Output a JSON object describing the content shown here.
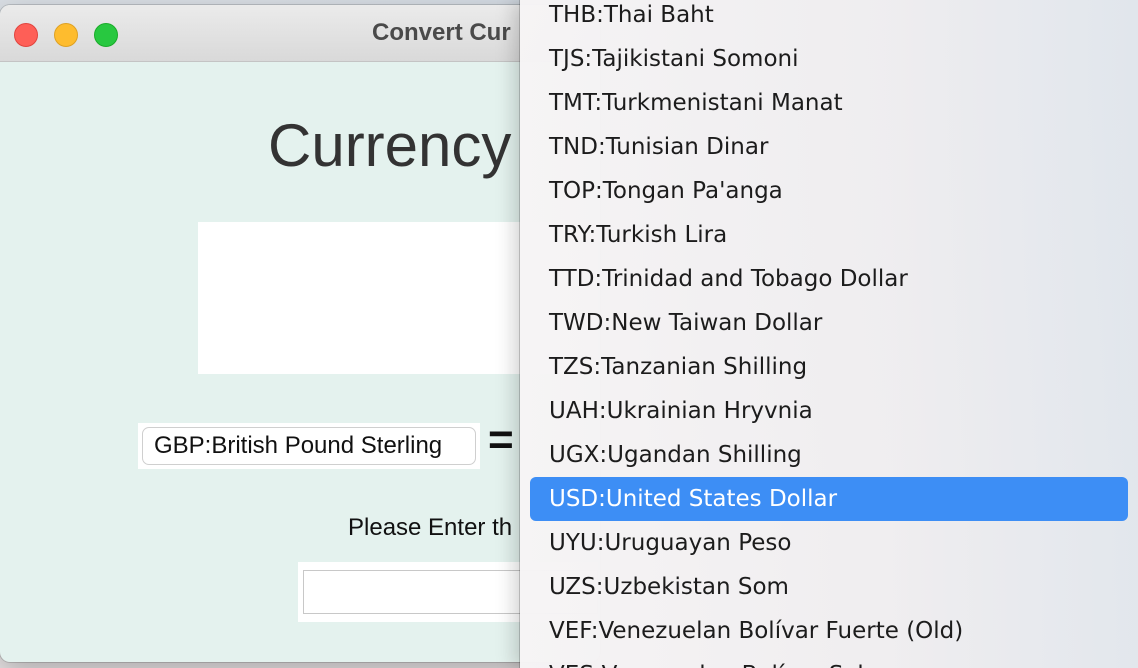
{
  "window": {
    "title": "Convert Cur"
  },
  "app": {
    "heading": "Currency",
    "from_currency": "GBP:British Pound Sterling",
    "equals_sign": "=",
    "prompt": "Please Enter th",
    "amount_value": "",
    "amount_placeholder": ""
  },
  "dropdown": {
    "selected": "USD:United States Dollar",
    "items": [
      "THB:Thai Baht",
      "TJS:Tajikistani Somoni",
      "TMT:Turkmenistani Manat",
      "TND:Tunisian Dinar",
      "TOP:Tongan Pa'anga",
      "TRY:Turkish Lira",
      "TTD:Trinidad and Tobago Dollar",
      "TWD:New Taiwan Dollar",
      "TZS:Tanzanian Shilling",
      "UAH:Ukrainian Hryvnia",
      "UGX:Ugandan Shilling",
      "USD:United States Dollar",
      "UYU:Uruguayan Peso",
      "UZS:Uzbekistan Som",
      "VEF:Venezuelan Bolívar Fuerte (Old)",
      "VES:Venezuelan Bolívar Sob"
    ]
  },
  "colors": {
    "window_background": "#e4f2ee",
    "selection_accent": "#3d8ef5",
    "close_button": "#fe5f57",
    "minimize_button": "#febc2e",
    "zoom_button": "#28c840"
  }
}
